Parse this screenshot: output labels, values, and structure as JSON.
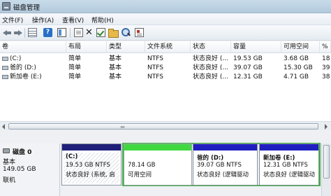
{
  "window": {
    "title": "磁盘管理"
  },
  "menu": [
    "文件(F)",
    "操作(A)",
    "查看(V)",
    "帮助(H)"
  ],
  "toolbar": {
    "icons": [
      "back-arrow-icon",
      "forward-arrow-icon",
      "show-hide-tree-icon",
      "help-icon",
      "properties-panel-icon",
      "document-icon",
      "delete-x-icon",
      "check-icon",
      "open-folder-icon",
      "find-icon",
      "properties-icon"
    ],
    "help_glyph": "?"
  },
  "volume_list": {
    "columns": [
      "卷",
      "布局",
      "类型",
      "文件系统",
      "状态",
      "容量",
      "可用空间",
      "%"
    ],
    "rows": [
      [
        "(C:)",
        "简单",
        "基本",
        "NTFS",
        "状态良好 (...",
        "19.53 GB",
        "3.68 GB",
        "18"
      ],
      [
        "爸的 (D:)",
        "简单",
        "基本",
        "NTFS",
        "状态良好 (...",
        "39.07 GB",
        "15.30 GB",
        "39"
      ],
      [
        "新加卷 (E:)",
        "简单",
        "基本",
        "NTFS",
        "状态良好 (...",
        "12.31 GB",
        "4.71 GB",
        "38"
      ]
    ]
  },
  "disk": {
    "name": "磁盘 0",
    "type": "基本",
    "size": "149.05 GB",
    "status": "联机"
  },
  "partitions": [
    {
      "label": "(C:)",
      "size": "19.53 GB NTFS",
      "status": "状态良好 (系统, 启",
      "bar_color": "#1f1f7a",
      "hatched": true
    },
    {
      "label": "",
      "size": "78.14 GB",
      "status": "可用空间",
      "bar_color": "#3fd83f",
      "hatched": false
    },
    {
      "label": "爸的 (D:)",
      "size": "39.07 GB NTFS",
      "status": "状态良好 (逻辑驱动",
      "bar_color": "#1f1fbf",
      "hatched": false
    },
    {
      "label": "新加卷 (E:)",
      "size": "12.31 GB NTFS",
      "status": "状态良好 (逻辑驱动",
      "bar_color": "#1f1fbf",
      "hatched": false
    }
  ],
  "colors": {
    "primary_partition": "#1f1f7a",
    "free_space": "#3fd83f",
    "logical_drive": "#1f1fbf",
    "extended_border": "#3fb43f"
  }
}
